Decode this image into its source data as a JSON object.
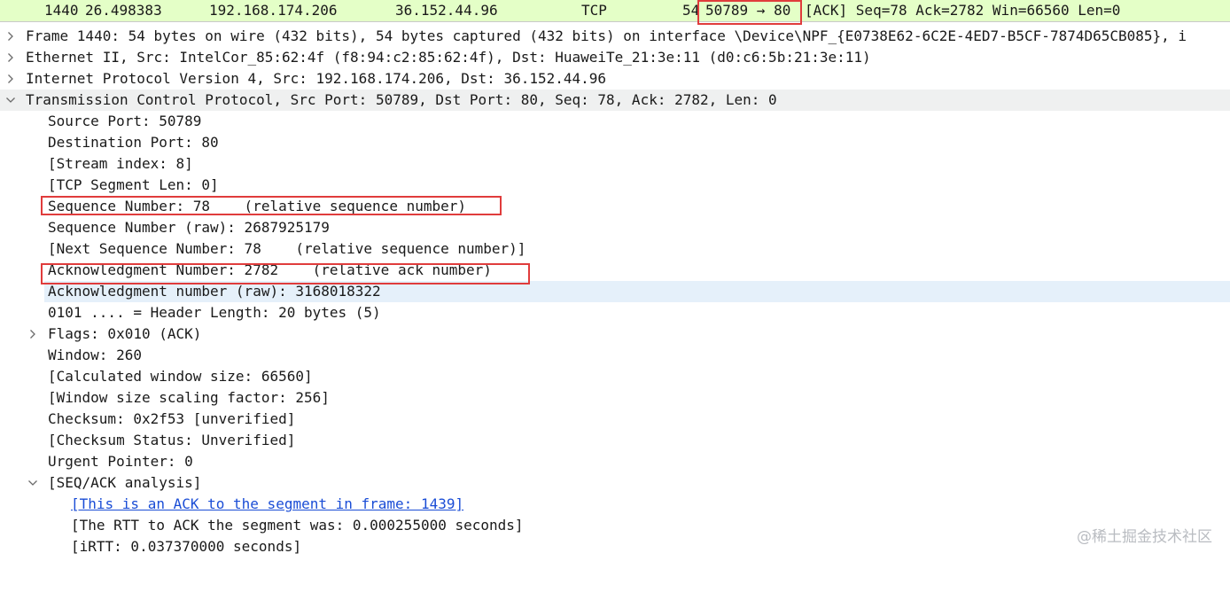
{
  "packet_list": {
    "no": "1440",
    "time": "26.498383",
    "source": "192.168.174.206",
    "destination": "36.152.44.96",
    "protocol": "TCP",
    "length": "54",
    "ports": "50789 → 80",
    "info": "[ACK] Seq=78 Ack=2782 Win=66560 Len=0"
  },
  "details": {
    "frame": "Frame 1440: 54 bytes on wire (432 bits), 54 bytes captured (432 bits) on interface \\Device\\NPF_{E0738E62-6C2E-4ED7-B5CF-7874D65CB085}, i",
    "ethernet": "Ethernet II, Src: IntelCor_85:62:4f (f8:94:c2:85:62:4f), Dst: HuaweiTe_21:3e:11 (d0:c6:5b:21:3e:11)",
    "ip": "Internet Protocol Version 4, Src: 192.168.174.206, Dst: 36.152.44.96",
    "tcp": "Transmission Control Protocol, Src Port: 50789, Dst Port: 80, Seq: 78, Ack: 2782, Len: 0",
    "tcp_fields": {
      "source_port": "Source Port: 50789",
      "destination_port": "Destination Port: 80",
      "stream_index": "[Stream index: 8]",
      "segment_len": "[TCP Segment Len: 0]",
      "seq": "Sequence Number: 78    (relative sequence number)",
      "seq_raw": "Sequence Number (raw): 2687925179",
      "next_seq": "[Next Sequence Number: 78    (relative sequence number)]",
      "ack": "Acknowledgment Number: 2782    (relative ack number)",
      "ack_raw": "Acknowledgment number (raw): 3168018322",
      "header_length": "0101 .... = Header Length: 20 bytes (5)",
      "flags": "Flags: 0x010 (ACK)",
      "window": "Window: 260",
      "calc_window": "[Calculated window size: 66560]",
      "scaling": "[Window size scaling factor: 256]",
      "checksum": "Checksum: 0x2f53 [unverified]",
      "checksum_status": "[Checksum Status: Unverified]",
      "urgent": "Urgent Pointer: 0",
      "seq_ack_analysis": "[SEQ/ACK analysis]"
    },
    "analysis": {
      "ack_link": "[This is an ACK to the segment in frame: 1439]",
      "rtt": "[The RTT to ACK the segment was: 0.000255000 seconds]",
      "irtt": "[iRTT: 0.037370000 seconds]"
    }
  },
  "watermark": "@稀土掘金技术社区",
  "colors": {
    "packet_row_bg": "#e4ffc7",
    "selected_row_bg": "#e5f0fa",
    "annotation_box": "#e03c3c",
    "link": "#1a4dd6"
  }
}
